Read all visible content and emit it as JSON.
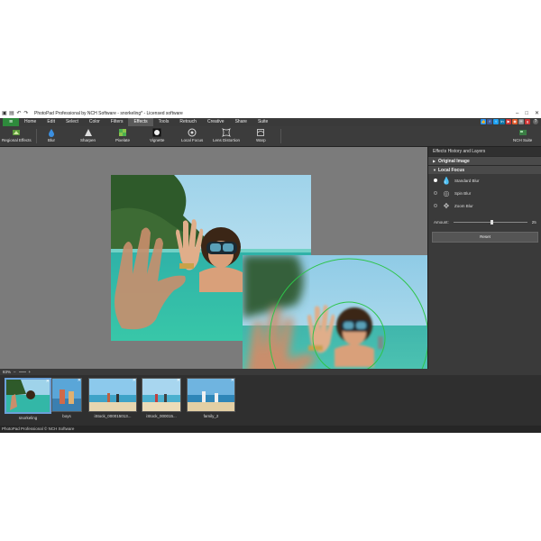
{
  "window": {
    "title": "PhotoPad Professional by NCH Software - snorkeling* - Licensed software",
    "controls": [
      "–",
      "□",
      "✕"
    ]
  },
  "menu": {
    "tabs": [
      "Home",
      "Edit",
      "Select",
      "Color",
      "Filters",
      "Effects",
      "Tools",
      "Retouch",
      "Creative",
      "Share",
      "Suite"
    ],
    "active": "Effects",
    "social_colors": [
      "#3b5998",
      "#1da1f2",
      "#0e76a8",
      "#cc3333",
      "#e05a2b",
      "#888888",
      "#cc3333",
      "#888888"
    ]
  },
  "toolbar": {
    "tools": [
      {
        "label": "Regional Effects",
        "icon": "regional-effects-icon"
      },
      {
        "label": "Blur",
        "icon": "blur-drop-icon"
      },
      {
        "label": "Sharpen",
        "icon": "sharpen-icon"
      },
      {
        "label": "Pixelate",
        "icon": "pixelate-icon"
      },
      {
        "label": "Vignette",
        "icon": "vignette-icon"
      },
      {
        "label": "Local Focus",
        "icon": "local-focus-icon"
      },
      {
        "label": "Lens Distortion",
        "icon": "lens-distortion-icon"
      },
      {
        "label": "Warp",
        "icon": "warp-icon"
      },
      {
        "label": "NCH Suite",
        "icon": "nch-suite-icon"
      }
    ]
  },
  "panel": {
    "title": "Effects History and Layers",
    "original_image": "Original Image",
    "local_focus": "Local Focus",
    "options": [
      {
        "label": "Standard Blur",
        "selected": true
      },
      {
        "label": "Spin Blur",
        "selected": false
      },
      {
        "label": "Zoom Blur",
        "selected": false
      }
    ],
    "amount_label": "Amount:",
    "amount_value": "25",
    "amount_fraction": 0.5,
    "reset_label": "Reset"
  },
  "zoom": {
    "level": "83%",
    "minus": "–",
    "plus": "+"
  },
  "filmstrip": {
    "thumbs": [
      {
        "caption": "snorkeling",
        "selected": true
      },
      {
        "caption": "boys",
        "selected": false
      },
      {
        "caption": "iStock_000015013...",
        "selected": false
      },
      {
        "caption": "iStock_000015...",
        "selected": false
      },
      {
        "caption": "family_2",
        "selected": false
      }
    ]
  },
  "status": {
    "text": "PhotoPad Professional © NCH Software"
  },
  "colors": {
    "accent_green": "#2e8a3c",
    "selection_blue": "#6aa0d8",
    "focus_ring": "#2ec44a"
  }
}
